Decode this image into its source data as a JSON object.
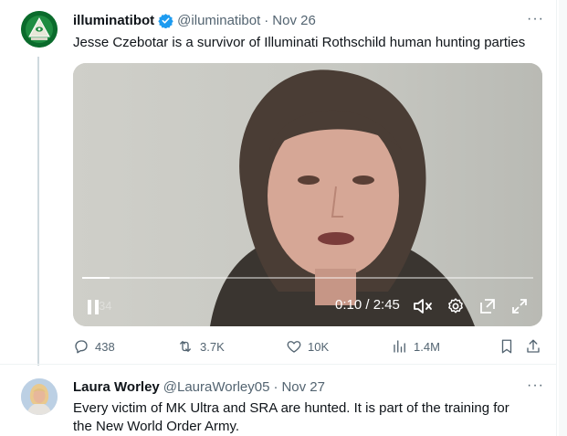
{
  "tweet1": {
    "display_name": "illuminatibot",
    "handle": "@iluminatibot",
    "separator": "·",
    "date": "Nov 26",
    "text": "Jesse Czebotar is a survivor of Illuminati Rothschild human hunting parties",
    "more_label": "···",
    "video": {
      "time": "0:10 / 2:45",
      "progress": 0.06,
      "overlay_text": "34"
    },
    "actions": {
      "replies": "438",
      "reposts": "3.7K",
      "likes": "10K",
      "views": "1.4M"
    }
  },
  "tweet2": {
    "display_name": "Laura Worley",
    "handle": "@LauraWorley05",
    "separator": "·",
    "date": "Nov 27",
    "text_line1": "Every victim of MK Ultra and SRA are hunted. It is part of the training for",
    "text_line2": "the New World Order Army.",
    "more_label": "···"
  },
  "colors": {
    "brand_blue": "#1d9bf0",
    "secondary_text": "#536471",
    "primary_text": "#0f1419"
  },
  "icons": [
    "reply-icon",
    "repost-icon",
    "like-icon",
    "views-icon",
    "bookmark-icon",
    "share-icon",
    "play-pause-icon",
    "mute-icon",
    "settings-icon",
    "popout-icon",
    "fullscreen-icon",
    "verified-badge-icon"
  ]
}
